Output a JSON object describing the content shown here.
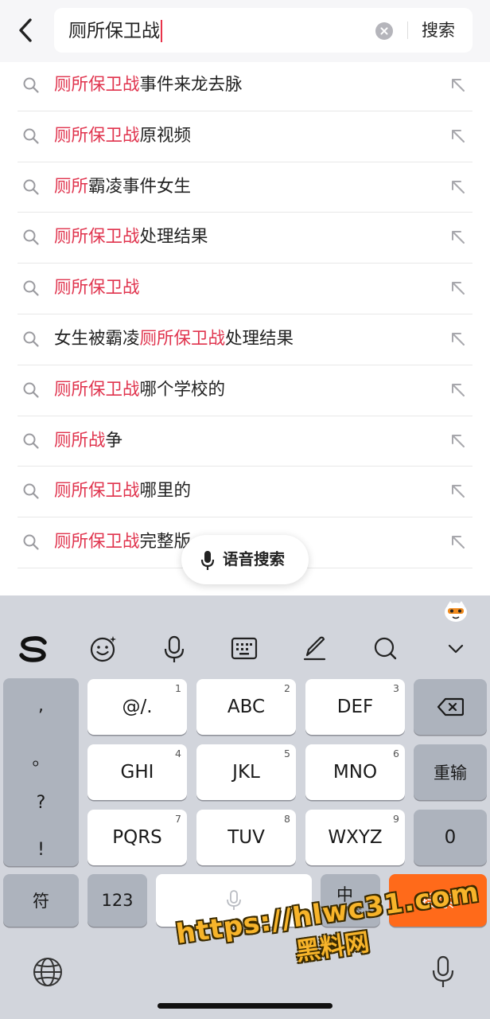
{
  "header": {
    "query": "厕所保卫战",
    "search_label": "搜索"
  },
  "suggestions": [
    {
      "pre": "",
      "hl": "厕所保卫战",
      "post": "事件来龙去脉"
    },
    {
      "pre": "",
      "hl": "厕所保卫战",
      "post": "原视频"
    },
    {
      "pre": "",
      "hl": "厕所",
      "post": "霸凌事件女生"
    },
    {
      "pre": "",
      "hl": "厕所保卫战",
      "post": "处理结果"
    },
    {
      "pre": "",
      "hl": "厕所保卫战",
      "post": ""
    },
    {
      "pre": "女生被霸凌",
      "hl": "厕所保卫战",
      "post": "处理结果"
    },
    {
      "pre": "",
      "hl": "厕所保卫战",
      "post": "哪个学校的"
    },
    {
      "pre": "",
      "hl": "厕所战",
      "post": "争"
    },
    {
      "pre": "",
      "hl": "厕所保卫战",
      "post": "哪里的"
    },
    {
      "pre": "",
      "hl": "厕所保卫战",
      "post": "完整版"
    }
  ],
  "voice_search_label": "语音搜索",
  "keyboard": {
    "punctuation": [
      ",",
      "。",
      "?",
      "!"
    ],
    "row1": [
      {
        "label": "@/.",
        "num": "1"
      },
      {
        "label": "ABC",
        "num": "2"
      },
      {
        "label": "DEF",
        "num": "3"
      }
    ],
    "row2": [
      {
        "label": "GHI",
        "num": "4"
      },
      {
        "label": "JKL",
        "num": "5"
      },
      {
        "label": "MNO",
        "num": "6"
      }
    ],
    "row3": [
      {
        "label": "PQRS",
        "num": "7"
      },
      {
        "label": "TUV",
        "num": "8"
      },
      {
        "label": "WXYZ",
        "num": "9"
      }
    ],
    "reenter_label": "重输",
    "zero_label": "0",
    "symbol_label": "符",
    "numbers_label": "123",
    "lang_main": "中",
    "lang_sub": "英",
    "search_label": "搜索"
  },
  "watermark": {
    "line1": "https://hlwc31.com",
    "line2": "黑料网"
  },
  "colors": {
    "highlight": "#e0334d",
    "caret": "#e8334a",
    "keyboard_bg": "#d2d5dc",
    "search_key": "#ff6a1a"
  }
}
